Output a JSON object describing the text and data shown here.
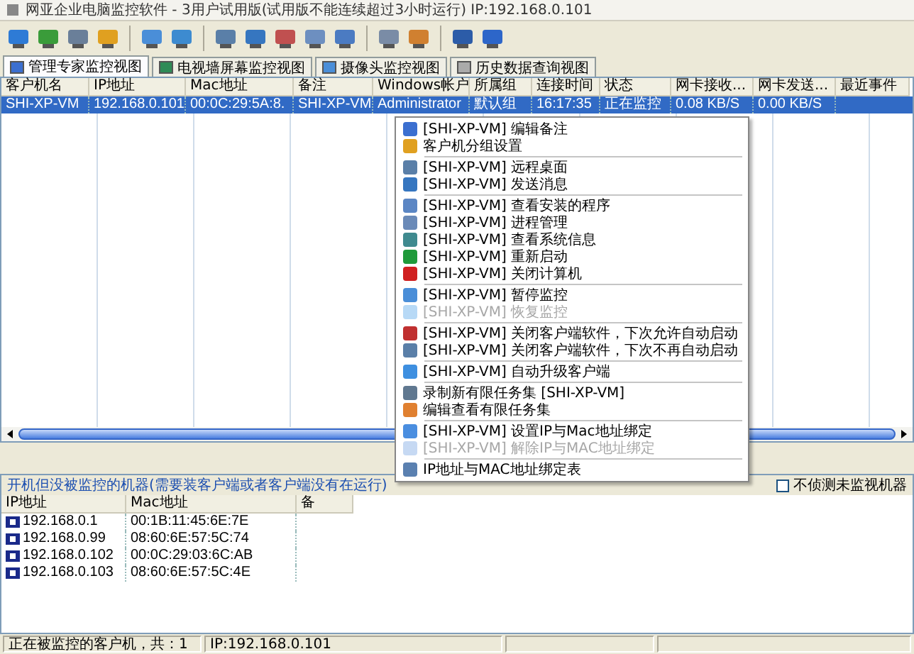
{
  "window": {
    "title": "网亚企业电脑监控软件 - 3用户试用版(试用版不能连续超过3小时运行) IP:192.168.0.101"
  },
  "tabs": [
    {
      "label": "管理专家监控视图",
      "selected": true
    },
    {
      "label": "电视墙屏幕监控视图",
      "selected": false
    },
    {
      "label": "摄像头监控视图",
      "selected": false
    },
    {
      "label": "历史数据查询视图",
      "selected": false
    }
  ],
  "clients_table": {
    "columns": [
      "客户机名",
      "IP地址",
      "Mac地址",
      "备注",
      "Windows帐户",
      "所属组",
      "连接时间",
      "状态",
      "网卡接收...",
      "网卡发送...",
      "最近事件"
    ],
    "rows": [
      {
        "selected": true,
        "cells": [
          "SHI-XP-VM",
          "192.168.0.101",
          "00:0C:29:5A:8.",
          "SHI-XP-VM",
          "Administrator",
          "默认组",
          "16:17:35",
          "正在监控",
          "0.08 KB/S",
          "0.00 KB/S"
        ]
      }
    ]
  },
  "context_menu": [
    {
      "kind": "item",
      "label": "[SHI-XP-VM] 编辑备注",
      "disabled": false
    },
    {
      "kind": "item",
      "label": "客户机分组设置",
      "disabled": false
    },
    {
      "kind": "separator"
    },
    {
      "kind": "item",
      "label": "[SHI-XP-VM] 远程桌面",
      "disabled": false
    },
    {
      "kind": "item",
      "label": "[SHI-XP-VM] 发送消息",
      "disabled": false
    },
    {
      "kind": "separator"
    },
    {
      "kind": "item",
      "label": "[SHI-XP-VM] 查看安装的程序",
      "disabled": false
    },
    {
      "kind": "item",
      "label": "[SHI-XP-VM] 进程管理",
      "disabled": false
    },
    {
      "kind": "item",
      "label": "[SHI-XP-VM] 查看系统信息",
      "disabled": false
    },
    {
      "kind": "item",
      "label": "[SHI-XP-VM] 重新启动",
      "disabled": false
    },
    {
      "kind": "item",
      "label": "[SHI-XP-VM] 关闭计算机",
      "disabled": false
    },
    {
      "kind": "separator"
    },
    {
      "kind": "item",
      "label": "[SHI-XP-VM] 暂停监控",
      "disabled": false
    },
    {
      "kind": "item",
      "label": "[SHI-XP-VM] 恢复监控",
      "disabled": true
    },
    {
      "kind": "separator"
    },
    {
      "kind": "item",
      "label": "[SHI-XP-VM] 关闭客户端软件，下次允许自动启动",
      "disabled": false
    },
    {
      "kind": "item",
      "label": "[SHI-XP-VM] 关闭客户端软件，下次不再自动启动",
      "disabled": false
    },
    {
      "kind": "separator"
    },
    {
      "kind": "item",
      "label": "[SHI-XP-VM] 自动升级客户端",
      "disabled": false
    },
    {
      "kind": "separator"
    },
    {
      "kind": "item",
      "label": "录制新有限任务集 [SHI-XP-VM]",
      "disabled": false
    },
    {
      "kind": "item",
      "label": "编辑查看有限任务集",
      "disabled": false
    },
    {
      "kind": "separator"
    },
    {
      "kind": "item",
      "label": "[SHI-XP-VM] 设置IP与Mac地址绑定",
      "disabled": false
    },
    {
      "kind": "item",
      "label": "[SHI-XP-VM] 解除IP与MAC地址绑定",
      "disabled": true
    },
    {
      "kind": "separator"
    },
    {
      "kind": "item",
      "label": "IP地址与MAC地址绑定表",
      "disabled": false
    }
  ],
  "unmonitored": {
    "title": "开机但没被监控的机器(需要装客户端或者客户端没有在运行)",
    "checkbox": {
      "label": "不侦测未监视机器",
      "checked": false
    },
    "columns": [
      "IP地址",
      "Mac地址",
      "备"
    ],
    "rows": [
      [
        "192.168.0.1",
        "00:1B:11:45:6E:7E"
      ],
      [
        "192.168.0.99",
        "08:60:6E:57:5C:74"
      ],
      [
        "192.168.0.102",
        "00:0C:29:03:6C:AB"
      ],
      [
        "192.168.0.103",
        "08:60:6E:57:5C:4E"
      ]
    ]
  },
  "status_bar": [
    "正在被监控的客户机，共：1",
    "IP:192.168.0.101"
  ]
}
